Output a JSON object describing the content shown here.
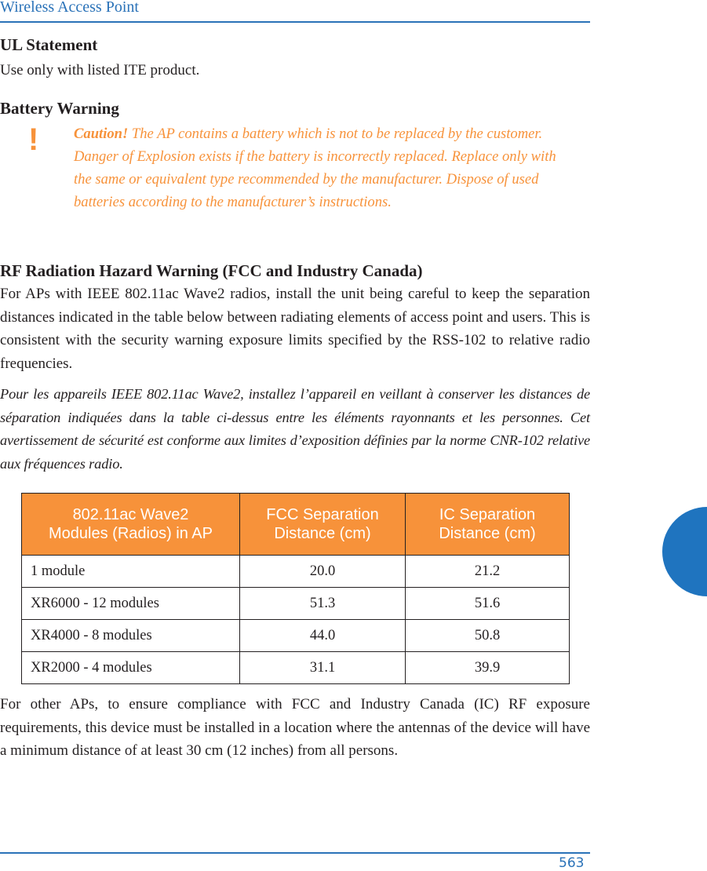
{
  "header": {
    "title": "Wireless Access Point"
  },
  "sections": {
    "ul": {
      "heading": "UL Statement",
      "body": "Use only with listed ITE product."
    },
    "battery": {
      "heading": "Battery Warning",
      "icon": "exclamation-icon",
      "icon_glyph": "!",
      "caution_label": "Caution!",
      "caution_text": " The AP contains a battery which is not to be replaced by the customer. Danger of Explosion exists if the battery is incorrectly replaced. Replace only with the same or equivalent type recommended by the manufacturer. Dispose of used batteries according to the manufacturer’s instructions."
    },
    "rf": {
      "heading": "RF Radiation Hazard Warning (FCC and Industry Canada)",
      "body_en": "For APs with IEEE 802.11ac Wave2 radios, install the unit being careful to keep the separation distances indicated in the table below between radiating elements of  access point and users. This is consistent with the security warning exposure limits specified by the RSS-102 to relative radio frequencies.",
      "body_fr": "Pour les appareils IEEE 802.11ac Wave2, installez l’appareil en veillant à conserver les distances de séparation indiquées dans la table ci-dessus entre les éléments rayonnants et les personnes. Cet avertissement de sécurité est conforme aux limites d’exposition définies par la norme CNR-102 relative aux fréquences radio.",
      "table": {
        "headers": [
          [
            "802.11ac Wave2",
            "Modules (Radios) in AP"
          ],
          [
            "FCC Separation",
            "Distance (cm)"
          ],
          [
            "IC Separation",
            "Distance (cm)"
          ]
        ],
        "rows": [
          [
            "1 module",
            "20.0",
            "21.2"
          ],
          [
            "XR6000 - 12 modules",
            "51.3",
            "51.6"
          ],
          [
            "XR4000 - 8 modules",
            "44.0",
            "50.8"
          ],
          [
            "XR2000 - 4 modules",
            "31.1",
            "39.9"
          ]
        ]
      },
      "body_other": "For other APs, to ensure compliance with FCC and Industry Canada (IC) RF exposure requirements, this device must be installed in a location where the antennas of the device will have a minimum distance of at least 30 cm (12 inches) from all persons."
    }
  },
  "footer": {
    "page_number": "563"
  },
  "colors": {
    "accent_blue": "#2a72b8",
    "caution_orange": "#f7923a",
    "thumb_tab": "#1f74bf"
  }
}
